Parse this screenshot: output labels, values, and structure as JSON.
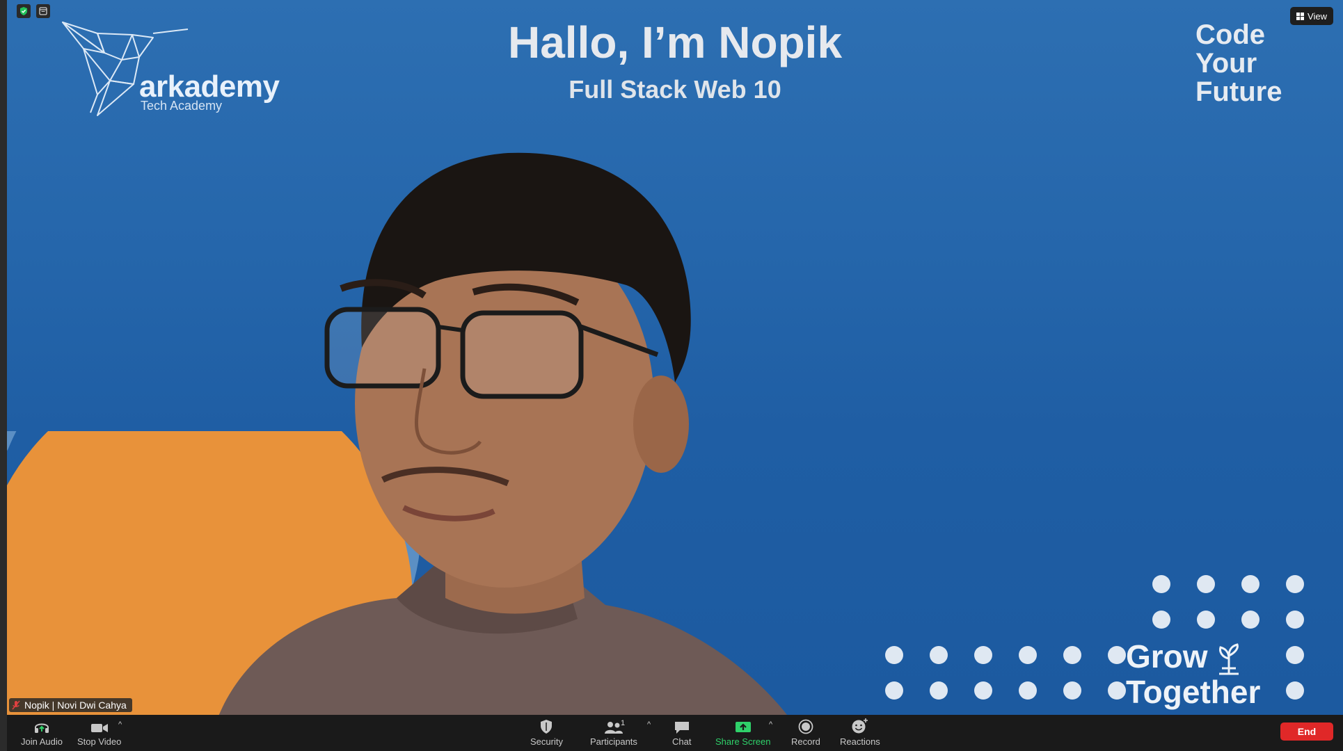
{
  "window": {
    "view_label": "View"
  },
  "slide": {
    "logo_word": "arkademy",
    "logo_sub": "Tech Academy",
    "headline": "Hallo, I’m Nopik",
    "subheadline": "Full Stack Web 10",
    "tagline": [
      "Code",
      "Your",
      "Future"
    ],
    "grow": [
      "Grow",
      "Together"
    ],
    "colors": {
      "background_top": "#2d6fb2",
      "background_bottom": "#1c5aa0",
      "orange": "#e8923a",
      "arc": "#5b8fc4"
    }
  },
  "participant": {
    "name_tag": "Nopik | Novi Dwi Cahya",
    "muted_icon": "mic-muted-icon"
  },
  "toolbar": {
    "join_audio": "Join Audio",
    "stop_video": "Stop Video",
    "security": "Security",
    "participants": "Participants",
    "participants_count": "1",
    "chat": "Chat",
    "share_screen": "Share Screen",
    "record": "Record",
    "reactions": "Reactions",
    "end": "End",
    "colors": {
      "share": "#2fd16a",
      "end": "#e02828"
    }
  }
}
